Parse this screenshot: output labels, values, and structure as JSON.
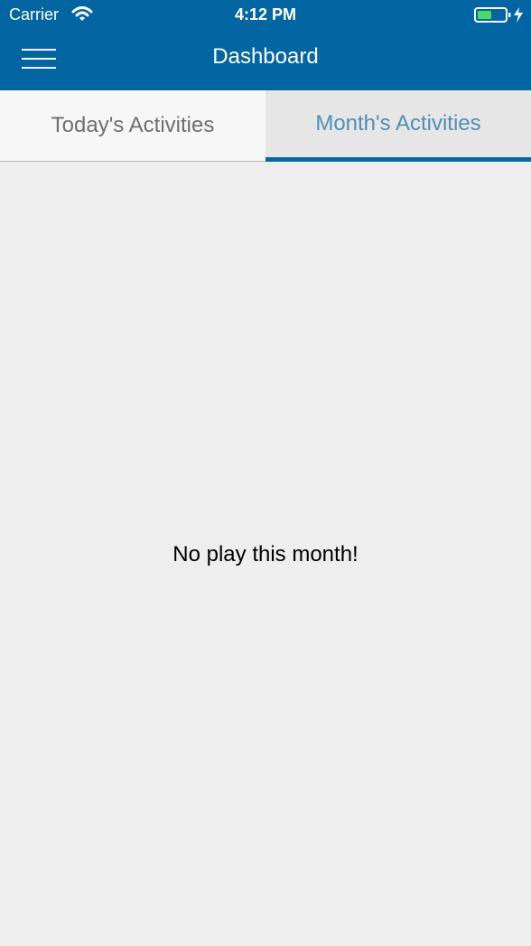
{
  "status_bar": {
    "carrier": "Carrier",
    "time": "4:12 PM",
    "icons": [
      "wifi-icon",
      "battery-charging-icon"
    ]
  },
  "nav": {
    "title": "Dashboard",
    "menu_icon": "hamburger-menu-icon"
  },
  "tabs": [
    {
      "label": "Today's Activities",
      "selected": false
    },
    {
      "label": "Month's Activities",
      "selected": true
    }
  ],
  "content": {
    "empty_message": "No play this month!"
  },
  "colors": {
    "header_bg": "#0366a3",
    "selected_tab_text": "#4f8fb7",
    "selected_tab_indicator": "#0a67a1",
    "unselected_tab_text": "#6f6f6f",
    "content_bg": "#eeeeee",
    "battery_fill": "#4cd964"
  }
}
